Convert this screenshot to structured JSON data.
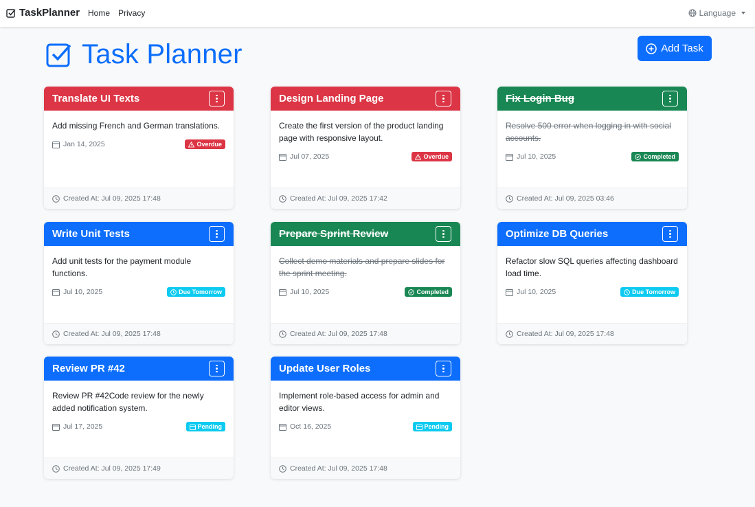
{
  "navbar": {
    "brand": "TaskPlanner",
    "links": [
      "Home",
      "Privacy"
    ],
    "language": "Language"
  },
  "header": {
    "title": "Task Planner",
    "add_button": "Add Task"
  },
  "colors": {
    "primary": "#0d6efd",
    "danger": "#dc3545",
    "success": "#198754",
    "info": "#0dcaf0"
  },
  "tasks": [
    {
      "title": "Translate UI Texts",
      "description": "Add missing French and German translations.",
      "due": "Jan 14, 2025",
      "status": "Overdue",
      "created": "Created At: Jul 09, 2025 17:48",
      "color": "red"
    },
    {
      "title": "Design Landing Page",
      "description": "Create the first version of the product landing page with responsive layout.",
      "due": "Jul 07, 2025",
      "status": "Overdue",
      "created": "Created At: Jul 09, 2025 17:42",
      "color": "red"
    },
    {
      "title": "Fix Login Bug",
      "description": "Resolve 500 error when logging in with social accounts.",
      "due": "Jul 10, 2025",
      "status": "Completed",
      "created": "Created At: Jul 09, 2025 03:46",
      "color": "green"
    },
    {
      "title": "Write Unit Tests",
      "description": "Add unit tests for the payment module functions.",
      "due": "Jul 10, 2025",
      "status": "Due Tomorrow",
      "created": "Created At: Jul 09, 2025 17:48",
      "color": "blue"
    },
    {
      "title": "Prepare Sprint Review",
      "description": "Collect demo materials and prepare slides for the sprint meeting.",
      "due": "Jul 10, 2025",
      "status": "Completed",
      "created": "Created At: Jul 09, 2025 17:48",
      "color": "green"
    },
    {
      "title": "Optimize DB Queries",
      "description": "Refactor slow SQL queries affecting dashboard load time.",
      "due": "Jul 10, 2025",
      "status": "Due Tomorrow",
      "created": "Created At: Jul 09, 2025 17:48",
      "color": "blue"
    },
    {
      "title": "Review PR #42",
      "description": "Review PR #42Code review for the newly added notification system.",
      "due": "Jul 17, 2025",
      "status": "Pending",
      "created": "Created At: Jul 09, 2025 17:49",
      "color": "blue"
    },
    {
      "title": "Update User Roles",
      "description": "Implement role-based access for admin and editor views.",
      "due": "Oct 16, 2025",
      "status": "Pending",
      "created": "Created At: Jul 09, 2025 17:48",
      "color": "blue"
    }
  ]
}
